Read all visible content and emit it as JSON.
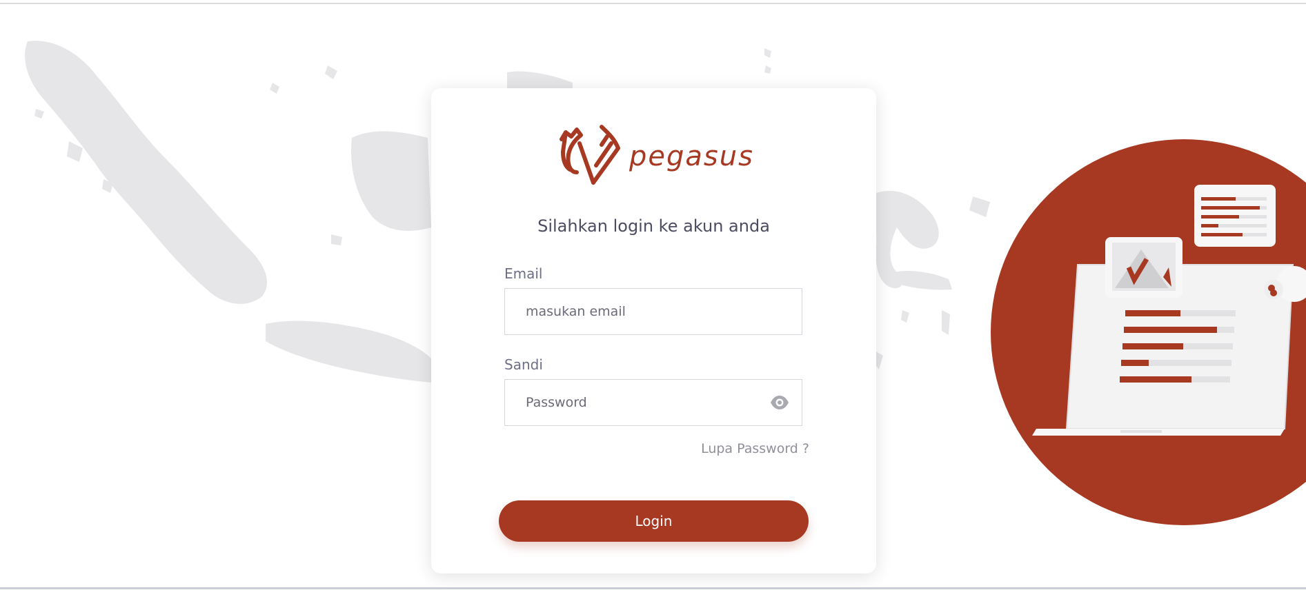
{
  "brand": {
    "name": "pegasus",
    "color": "#a73822"
  },
  "login": {
    "heading": "Silahkan login ke akun anda",
    "email": {
      "label": "Email",
      "placeholder": "masukan email",
      "value": ""
    },
    "password": {
      "label": "Sandi",
      "placeholder": "Password",
      "value": "",
      "toggle_icon": "eye-icon"
    },
    "forgot_link": "Lupa Password ?",
    "submit_label": "Login"
  },
  "colors": {
    "accent": "#a73822",
    "map_gray": "#e6e6e8",
    "text": "#4c4c61"
  }
}
